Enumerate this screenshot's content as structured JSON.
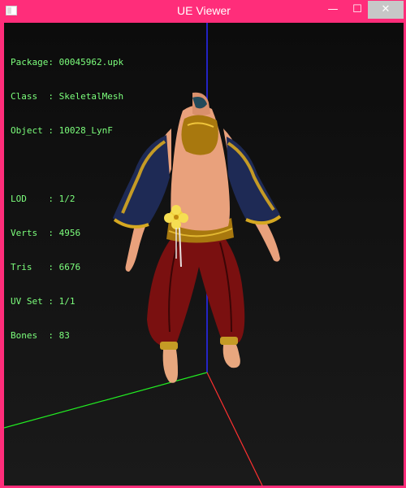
{
  "window": {
    "title": "UE Viewer",
    "controls": {
      "minimize": "—",
      "maximize": "☐",
      "close": "✕"
    }
  },
  "info": {
    "package": {
      "label": "Package:",
      "value": "00045962.upk"
    },
    "class": {
      "label": "Class  :",
      "value": "SkeletalMesh"
    },
    "object": {
      "label": "Object :",
      "value": "10028_LynF"
    },
    "lod": {
      "label": "LOD    :",
      "value": "1/2"
    },
    "verts": {
      "label": "Verts  :",
      "value": "4956"
    },
    "tris": {
      "label": "Tris   :",
      "value": "6676"
    },
    "uvset": {
      "label": "UV Set :",
      "value": "1/1"
    },
    "bones": {
      "label": "Bones  :",
      "value": "83"
    }
  },
  "colors": {
    "frame": "#ff2d7a",
    "info_text": "#7cff7c",
    "axis_x": "#ff3030",
    "axis_y": "#22ee22",
    "axis_z": "#2a2aff"
  }
}
